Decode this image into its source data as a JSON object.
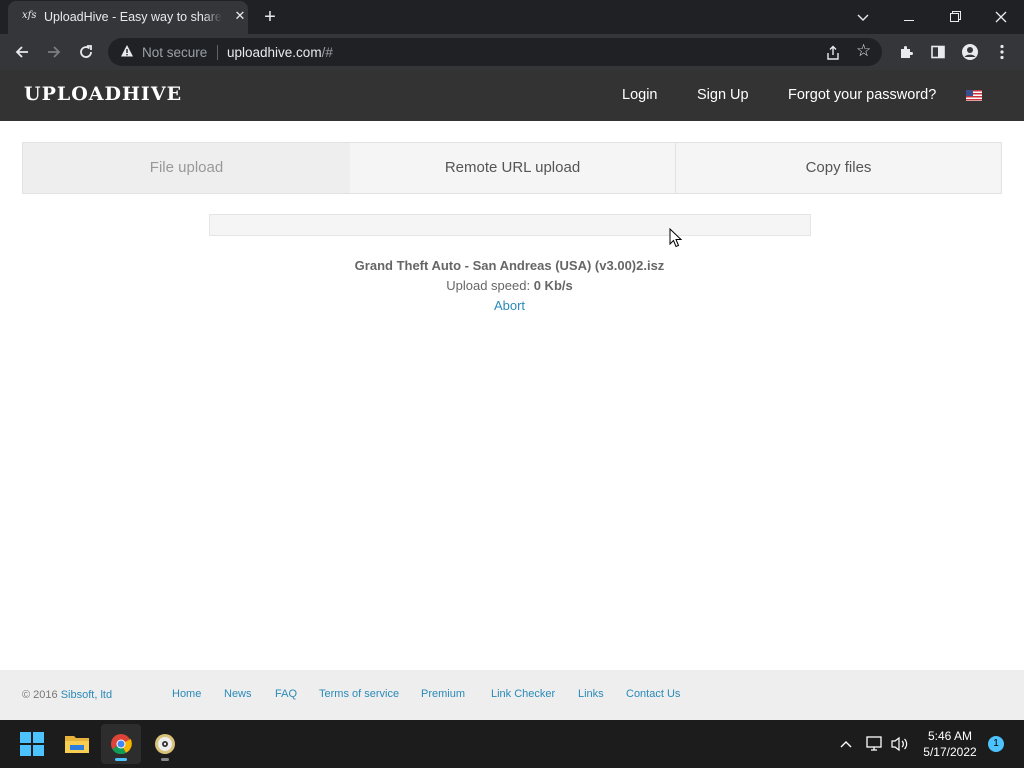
{
  "browser": {
    "tab_title": "UploadHive - Easy way to share your files",
    "favicon_text": "xfs",
    "url_host": "uploadhive.com",
    "url_path": "/#",
    "security_label": "Not secure"
  },
  "site": {
    "logo": "UPLOADHIVE",
    "nav": {
      "login": "Login",
      "signup": "Sign Up",
      "forgot": "Forgot your password?"
    }
  },
  "upload_tabs": [
    {
      "label": "File upload",
      "active": true
    },
    {
      "label": "Remote URL upload",
      "active": false
    },
    {
      "label": "Copy files",
      "active": false
    }
  ],
  "upload": {
    "progress": 0,
    "filename": "Grand Theft Auto - San Andreas (USA) (v3.00)2.isz",
    "speed_label": "Upload speed:",
    "speed_value": "0 Kb/s",
    "abort_label": "Abort"
  },
  "footer": {
    "copyright_prefix": "© 2016",
    "company": "Sibsoft, ltd",
    "links": [
      "Home",
      "News",
      "FAQ",
      "Terms of service",
      "Premium",
      "Link Checker",
      "Links",
      "Contact Us"
    ]
  },
  "taskbar": {
    "time": "5:46 AM",
    "date": "5/17/2022",
    "notification_count": "1"
  },
  "colors": {
    "link": "#2a8ab8",
    "header_bg": "#333333",
    "chrome_bg": "#202124",
    "taskbar_accent": "#4cc2ff"
  }
}
